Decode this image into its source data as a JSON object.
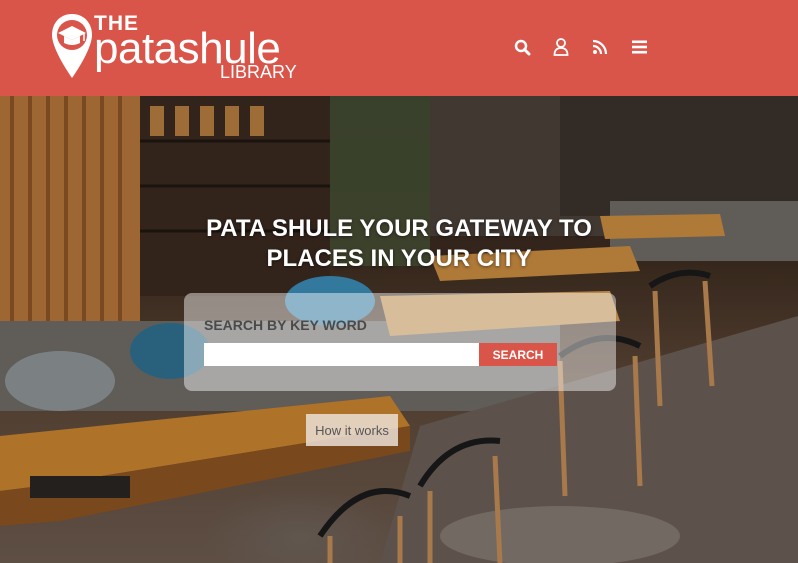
{
  "brand": {
    "the": "THE",
    "name": "patashule",
    "library": "LIBRARY",
    "color": "#d9554a"
  },
  "nav": {
    "icons": [
      "search-icon",
      "user-icon",
      "rss-icon",
      "menu-icon"
    ]
  },
  "hero": {
    "title_line1": "PATA SHULE YOUR GATEWAY TO",
    "title_line2": "PLACES IN YOUR CITY"
  },
  "search": {
    "label": "SEARCH BY KEY WORD",
    "value": "",
    "placeholder": "",
    "button_label": "SEARCH"
  },
  "how_it_works": {
    "label": "How it works"
  }
}
